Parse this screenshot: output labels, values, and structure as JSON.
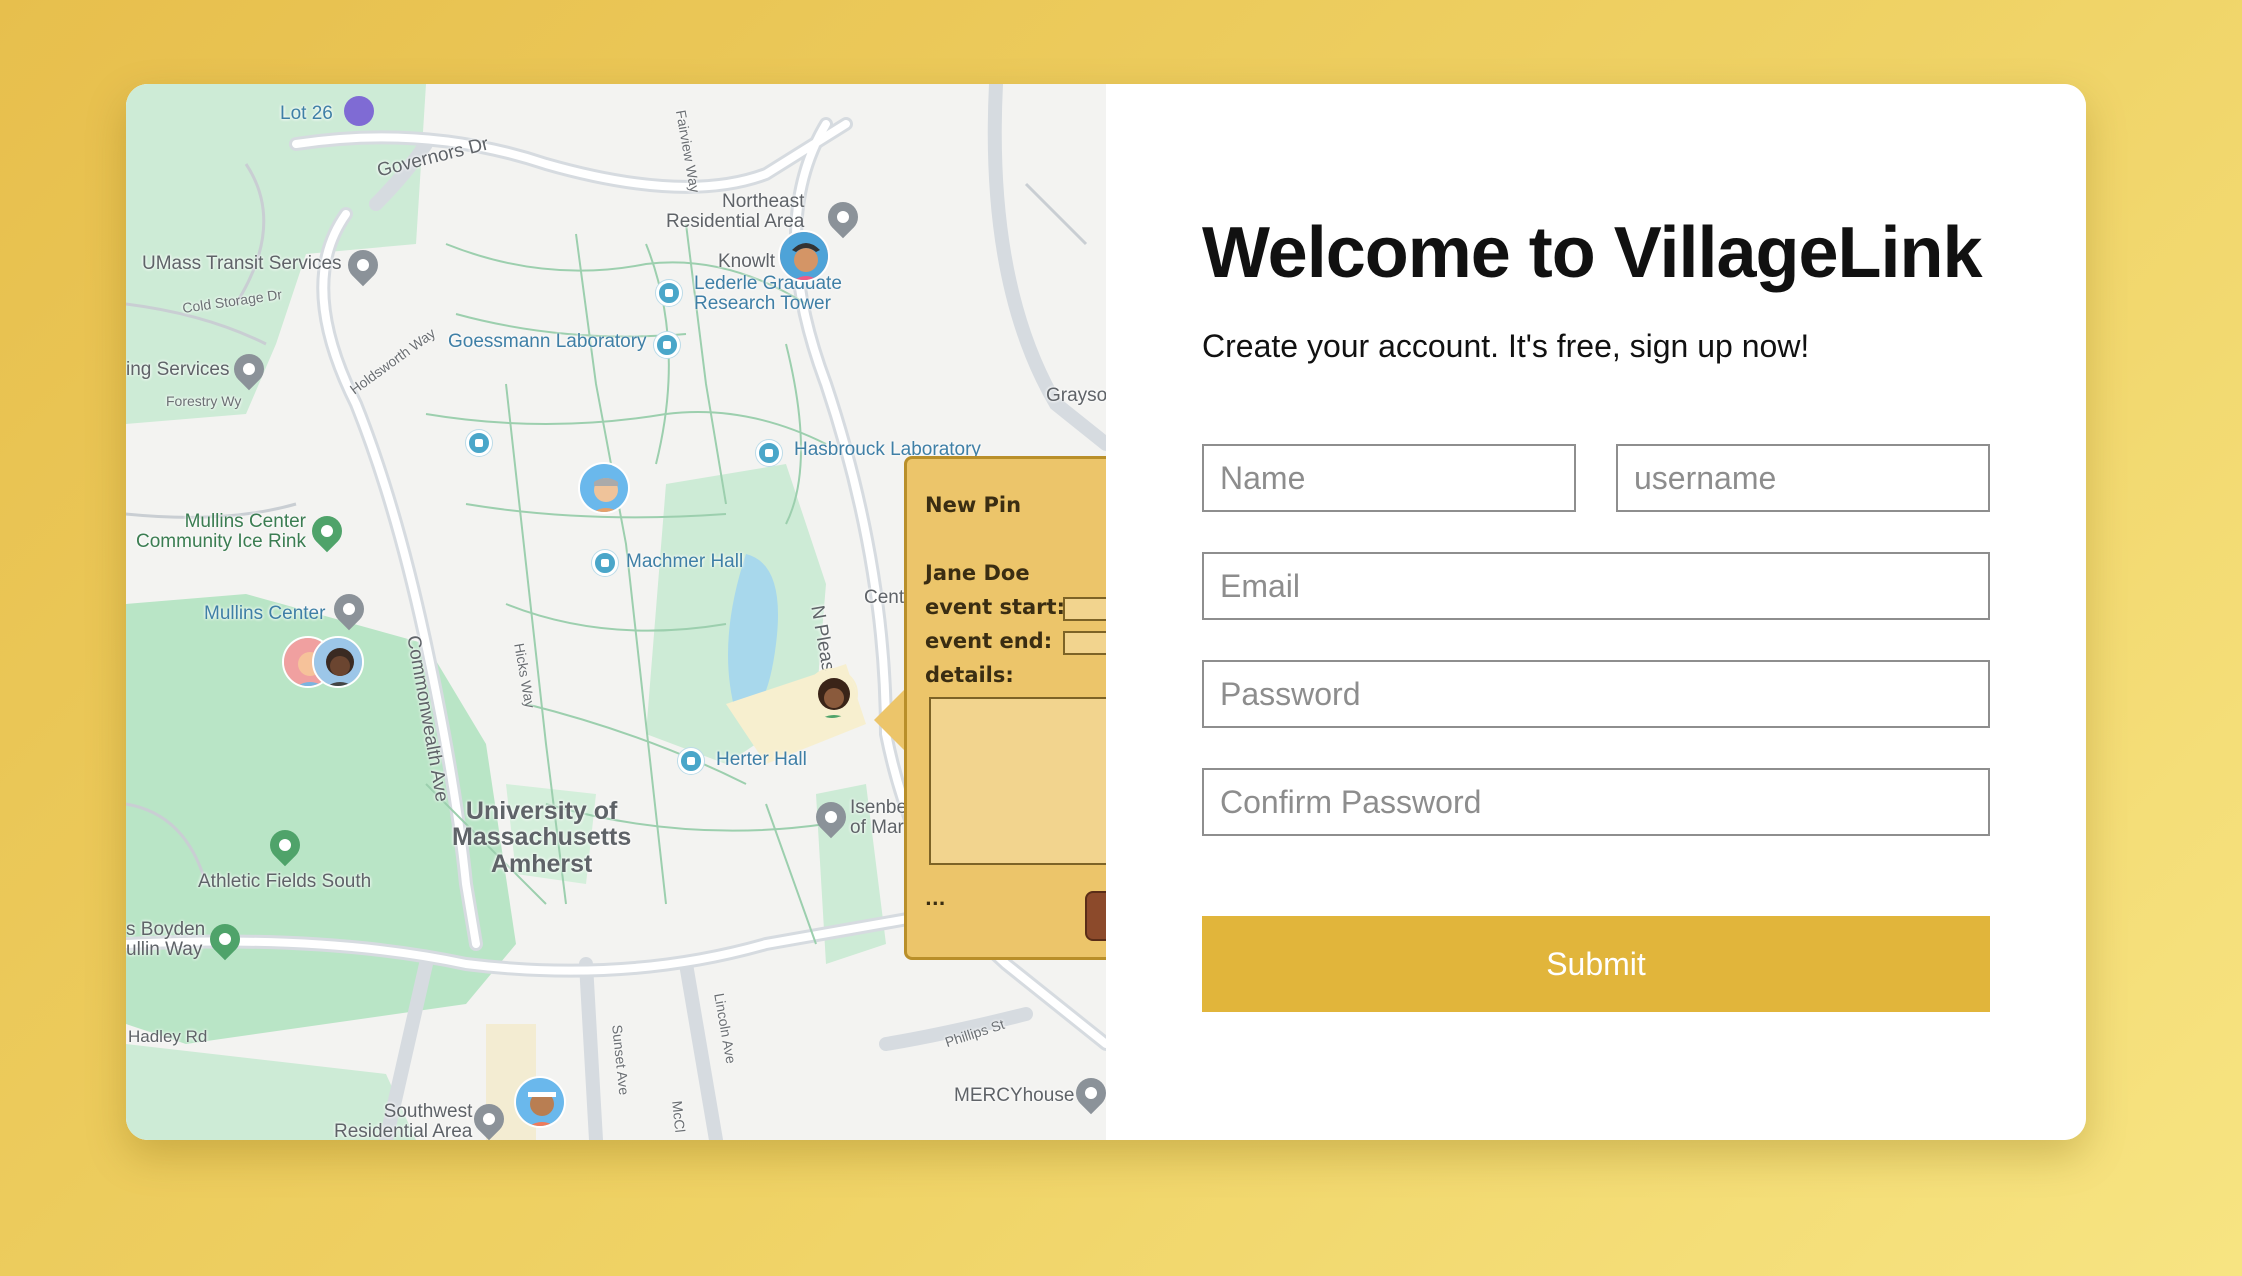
{
  "map": {
    "labels": {
      "lot26": "Lot 26",
      "governors": "Governors Dr",
      "fairview": "Fairview Way",
      "northeast": "Northeast\nResidential Area",
      "knowlton": "Knowlt",
      "umass_transit": "UMass Transit Services",
      "cold_storage": "Cold Storage Dr",
      "lederle": "Lederle Graduate\nResearch Tower",
      "goessmann": "Goessmann Laboratory",
      "holdsworth": "Holdsworth Way",
      "services": "ing Services",
      "forestry": "Forestry Wy",
      "grayson": "Grayso",
      "hasbrouck": "Hasbrouck Laboratory",
      "mullins_rink": "Mullins Center\nCommunity Ice Rink",
      "machmer": "Machmer Hall",
      "commonwealth": "Commonwealth Ave",
      "mullins_center": "Mullins Center",
      "hicks": "Hicks Way",
      "n_pleasant": "N Pleasa",
      "cent": "Cent",
      "herter": "Herter Hall",
      "umass": "University of\nMassachusetts\nAmherst",
      "isenberg": "Isenbe\nof Mar",
      "athletic": "Athletic Fields South",
      "boyden": "s Boyden\nullin Way",
      "hadley": "Hadley Rd",
      "sunset": "Sunset Ave",
      "lincoln": "Lincoln Ave",
      "phillips": "Phillips St",
      "mercy": "MERCYhouse",
      "southwest": "Southwest\nResidential Area",
      "mcclellan": "McCl"
    },
    "popup": {
      "title": "New Pin",
      "name": "Jane Doe",
      "event_start": "event start:",
      "event_end": "event end:",
      "details": "details:",
      "more": "..."
    }
  },
  "form": {
    "title": "Welcome to VillageLink",
    "subtitle": "Create your account. It's free, sign up now!",
    "name_placeholder": "Name",
    "username_placeholder": "username",
    "email_placeholder": "Email",
    "password_placeholder": "Password",
    "confirm_placeholder": "Confirm Password",
    "submit_label": "Submit"
  },
  "colors": {
    "accent": "#e1b53b",
    "background": "#efd265",
    "popup": "#ecc56a"
  }
}
